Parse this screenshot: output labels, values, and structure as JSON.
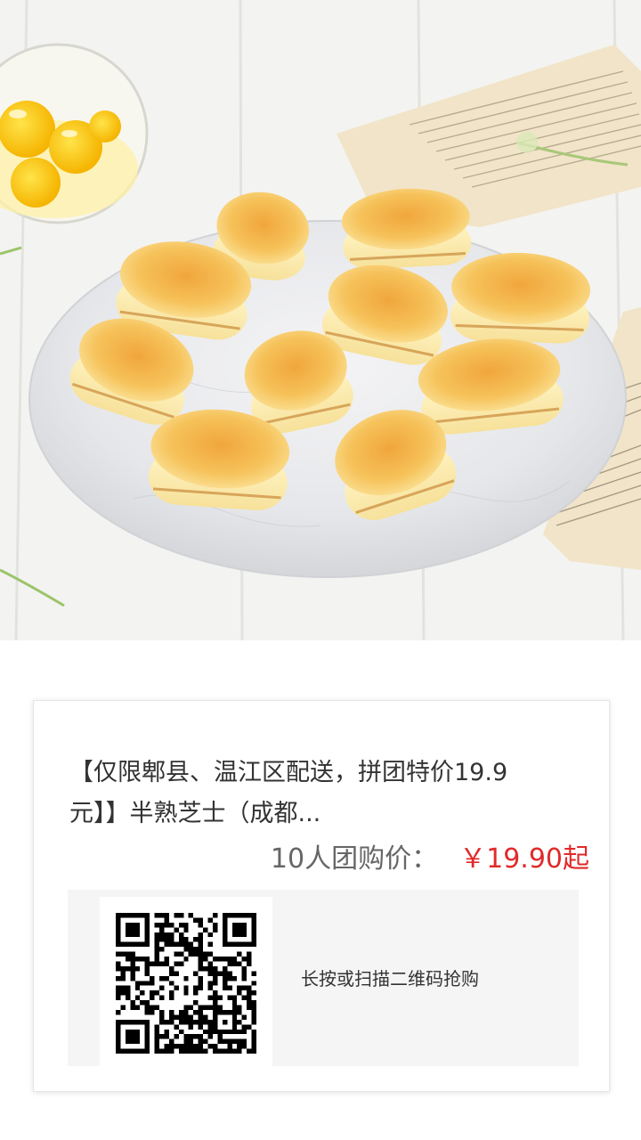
{
  "product": {
    "title": "【仅限郫县、温江区配送，拼团特价19.9元】】半熟芝士（成都...",
    "image_alt": "半熟芝士"
  },
  "price": {
    "label": "10人团购价：",
    "value": "￥19.90起",
    "color": "#e02a2a"
  },
  "qr": {
    "hint": "长按或扫描二维码抢购",
    "icon": "qr-code-icon"
  }
}
